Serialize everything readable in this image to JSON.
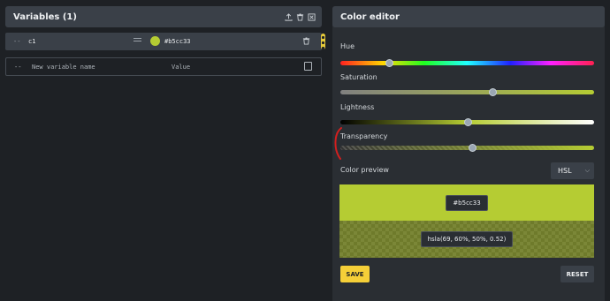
{
  "variables_panel": {
    "title": "Variables (1)",
    "icons": [
      "upload-icon",
      "trash-icon",
      "close-box-icon"
    ],
    "rows": [
      {
        "dash": "--",
        "name": "c1",
        "value": "#b5cc33"
      }
    ],
    "new_row": {
      "dash": "--",
      "name_placeholder": "New variable name",
      "value_placeholder": "Value"
    }
  },
  "color_editor": {
    "title": "Color editor",
    "hue_label": "Hue",
    "saturation_label": "Saturation",
    "lightness_label": "Lightness",
    "transparency_label": "Transparency",
    "hue": 69,
    "saturation": 60,
    "lightness": 50,
    "alpha": 0.52,
    "preview_label": "Color preview",
    "format_select": "HSL",
    "hex_value": "#b5cc33",
    "hsla_value": "hsla(69, 60%, 50%, 0.52)",
    "save_label": "SAVE",
    "reset_label": "RESET"
  },
  "colors": {
    "accent": "#f5cf38",
    "swatch": "#b5cc33",
    "annotation": "#d21f1f"
  }
}
